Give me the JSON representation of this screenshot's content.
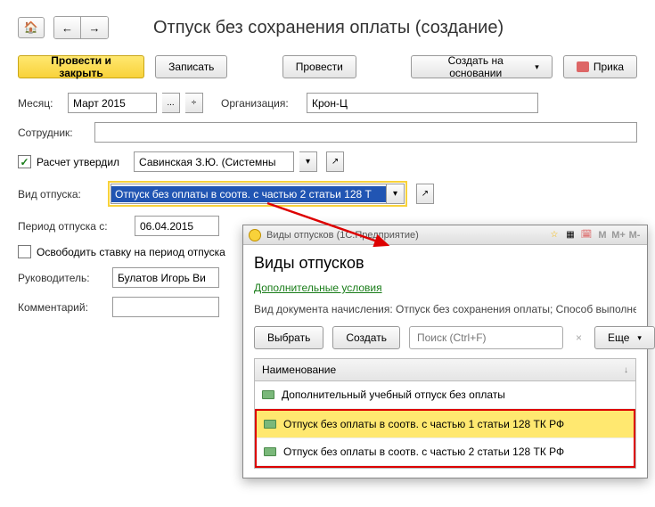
{
  "title": "Отпуск без сохранения оплаты (создание)",
  "toolbar": {
    "post_close": "Провести и закрыть",
    "save": "Записать",
    "post": "Провести",
    "create_based": "Создать на основании",
    "print": "Прика"
  },
  "form": {
    "month_label": "Месяц:",
    "month_value": "Март 2015",
    "org_label": "Организация:",
    "org_value": "Крон-Ц",
    "employee_label": "Сотрудник:",
    "employee_value": "",
    "calc_approved_label": "Расчет утвердил",
    "approver_value": "Савинская З.Ю. (Системны",
    "leave_type_label": "Вид отпуска:",
    "leave_type_value": "Отпуск без оплаты в соотв. с частью 2 статьи 128 Т",
    "period_from_label": "Период отпуска с:",
    "period_from_value": "06.04.2015",
    "free_rate_label": "Освободить ставку на период отпуска",
    "manager_label": "Руководитель:",
    "manager_value": "Булатов Игорь Ви",
    "comment_label": "Комментарий:",
    "comment_value": ""
  },
  "popup": {
    "titlebar": "Виды отпусков   (1С:Предприятие)",
    "header": "Виды отпусков",
    "extra_link": "Дополнительные условия",
    "info": "Вид документа начисления: Отпуск без сохранения оплаты; Способ выполне",
    "select_btn": "Выбрать",
    "create_btn": "Создать",
    "search_placeholder": "Поиск (Ctrl+F)",
    "more_btn": "Еще",
    "column_name": "Наименование",
    "rows": [
      "Дополнительный учебный отпуск без оплаты",
      "Отпуск без оплаты в соотв. с частью 1 статьи 128 ТК РФ",
      "Отпуск без оплаты в соотв. с частью 2 статьи 128 ТК РФ"
    ]
  }
}
